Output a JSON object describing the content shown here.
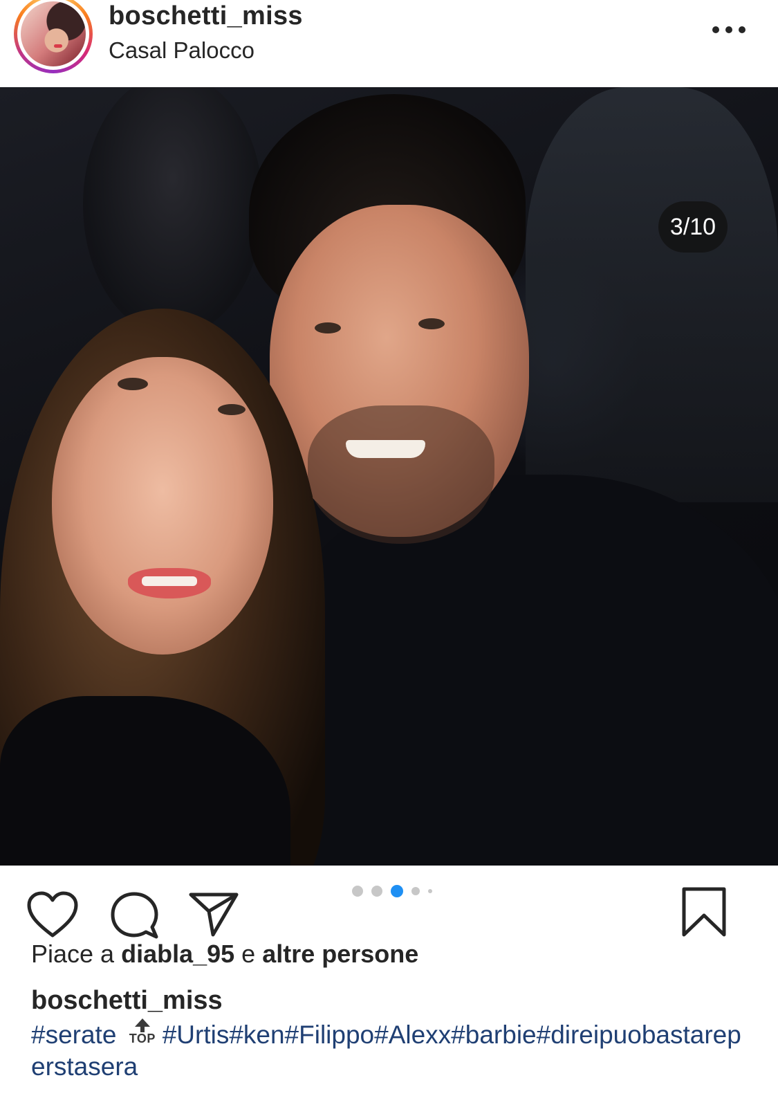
{
  "post": {
    "username": "boschetti_miss",
    "location": "Casal Palocco",
    "carousel_counter": "3/10",
    "carousel": {
      "total_dots_visible": 5,
      "active_dot_index": 2
    }
  },
  "likes": {
    "prefix": "Piace a ",
    "user": "diabla_95",
    "middle": " e ",
    "rest": "altre persone"
  },
  "caption": {
    "username": "boschetti_miss",
    "tag_first": "#serate",
    "top_badge": "TOP",
    "tags_rest": "#Urtis#ken#Filippo#Alexx#barbie#direipuobastareperstasera"
  },
  "icons": {
    "more": "more-options-icon",
    "like": "heart-icon",
    "comment": "comment-icon",
    "share": "send-icon",
    "save": "bookmark-icon"
  },
  "colors": {
    "active_dot": "#1e8ff3",
    "text": "#262626",
    "hashtag": "#1f3f73"
  }
}
